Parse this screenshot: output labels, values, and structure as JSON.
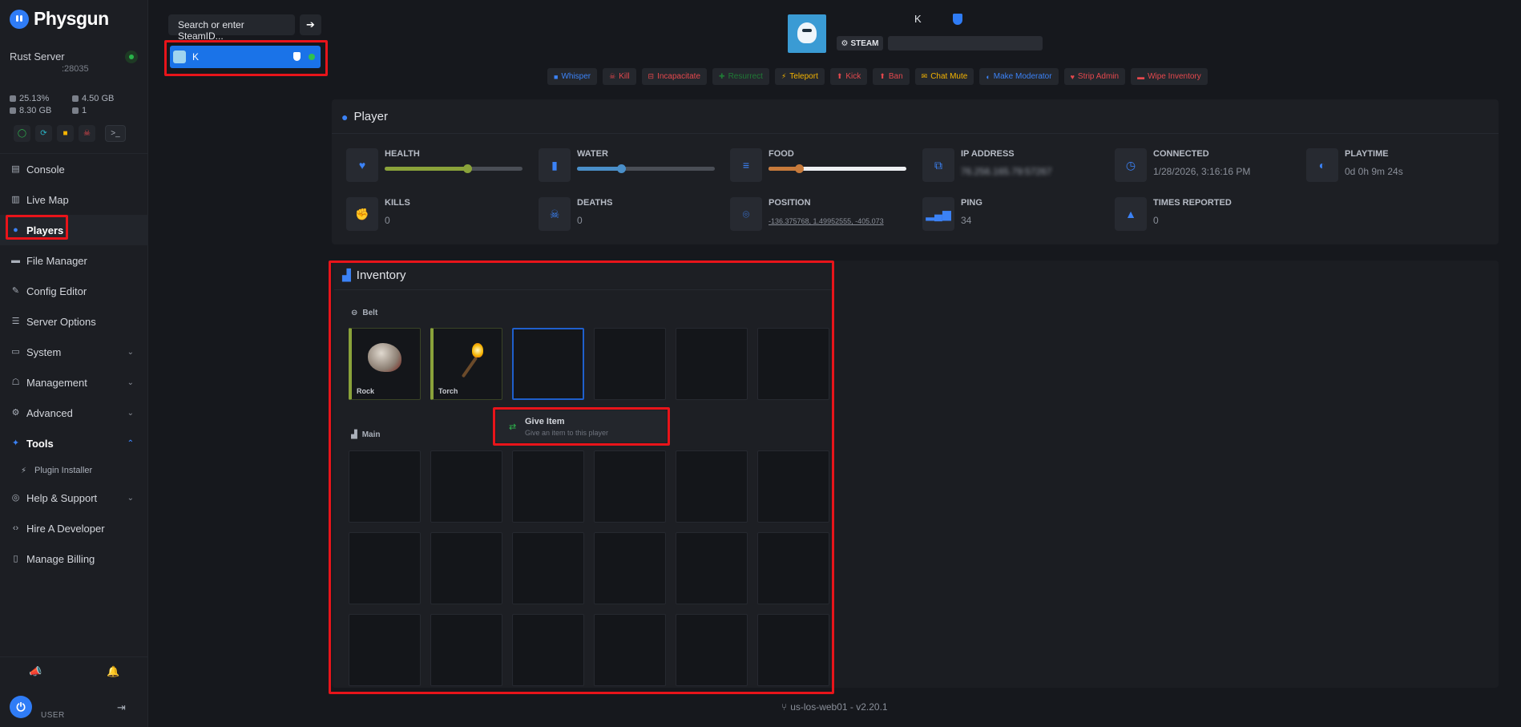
{
  "brand": {
    "name": "Physgun"
  },
  "server": {
    "name": "Rust Server",
    "port": ":28035",
    "stats": {
      "cpu": "25.13%",
      "ram": "4.50 GB",
      "disk": "8.30 GB",
      "players": "1"
    },
    "controls": [
      "start-icon",
      "restart-icon",
      "stop-icon",
      "kill-icon",
      "terminal-icon"
    ]
  },
  "nav": {
    "console": "Console",
    "live_map": "Live Map",
    "players": "Players",
    "file_manager": "File Manager",
    "config_editor": "Config Editor",
    "server_options": "Server Options",
    "system": "System",
    "management": "Management",
    "advanced": "Advanced",
    "tools": "Tools",
    "plugin_installer": "Plugin Installer",
    "help_support": "Help & Support",
    "hire_developer": "Hire A Developer",
    "manage_billing": "Manage Billing"
  },
  "user": {
    "label": "USER",
    "avatar_letter": "⏻"
  },
  "search": {
    "value": "Search or enter SteamID...",
    "go": "➔"
  },
  "player_list": [
    {
      "name": "K"
    }
  ],
  "header": {
    "name": "K",
    "steam_label": "STEAM"
  },
  "actions": [
    {
      "label": "Whisper",
      "color": "#3b82f6",
      "icon": "■"
    },
    {
      "label": "Kill",
      "color": "#e5484d",
      "icon": "☠"
    },
    {
      "label": "Incapacitate",
      "color": "#e5484d",
      "icon": "⊟"
    },
    {
      "label": "Resurrect",
      "color": "#1f7a35",
      "icon": "✚"
    },
    {
      "label": "Teleport",
      "color": "#f5b400",
      "icon": "⚡"
    },
    {
      "label": "Kick",
      "color": "#e5484d",
      "icon": "⬆"
    },
    {
      "label": "Ban",
      "color": "#e5484d",
      "icon": "⬆"
    },
    {
      "label": "Chat Mute",
      "color": "#f5b400",
      "icon": "✉"
    },
    {
      "label": "Make Moderator",
      "color": "#3b82f6",
      "icon": "◐"
    },
    {
      "label": "Strip Admin",
      "color": "#e5484d",
      "icon": "♥"
    },
    {
      "label": "Wipe Inventory",
      "color": "#e5484d",
      "icon": "▬"
    }
  ],
  "player_panel": {
    "title": "Player",
    "health": {
      "label": "HEALTH",
      "value": 0.6,
      "color": "#8aa23a"
    },
    "water": {
      "label": "WATER",
      "value": 0.32,
      "color": "#4a8fc9"
    },
    "food": {
      "label": "FOOD",
      "value": 0.22,
      "color": "#c77a3b"
    },
    "ip": {
      "label": "IP ADDRESS",
      "value": "76.256.165.79:57267"
    },
    "connected": {
      "label": "CONNECTED",
      "value": "1/28/2026, 3:16:16 PM"
    },
    "playtime": {
      "label": "PLAYTIME",
      "value": "0d 0h 9m 24s"
    },
    "kills": {
      "label": "KILLS",
      "value": "0"
    },
    "deaths": {
      "label": "DEATHS",
      "value": "0"
    },
    "position": {
      "label": "POSITION",
      "value": "-136.375768, 1.49952555, -405.073"
    },
    "ping": {
      "label": "PING",
      "value": "34"
    },
    "reports": {
      "label": "TIMES REPORTED",
      "value": "0"
    }
  },
  "inventory": {
    "title": "Inventory",
    "belt_label": "Belt",
    "main_label": "Main",
    "belt": [
      {
        "name": "Rock"
      },
      {
        "name": "Torch"
      },
      {
        "name": ""
      },
      {
        "name": ""
      },
      {
        "name": ""
      },
      {
        "name": ""
      }
    ],
    "give_item": {
      "title": "Give Item",
      "subtitle": "Give an item to this player"
    }
  },
  "footer": {
    "version": "us-los-web01 - v2.20.1"
  }
}
